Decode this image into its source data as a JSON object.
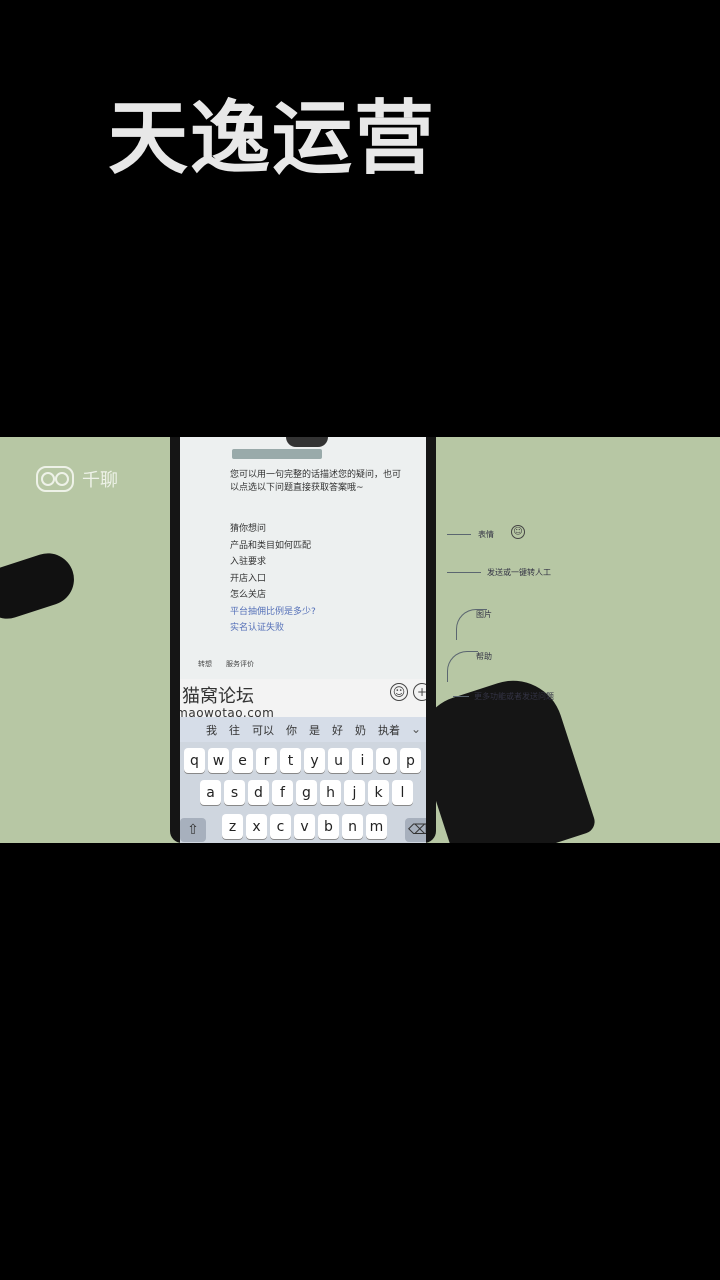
{
  "header": {
    "title": "天逸运营"
  },
  "brand": {
    "logo_text": "千聊"
  },
  "chat": {
    "message": "您可以用一句完整的话描述您的疑问，也可以点选以下问题直接获取答案哦~",
    "menu_heading": "猜你想问",
    "menu_items": [
      "产品和类目如何匹配",
      "入驻要求",
      "开店入口",
      "怎么关店",
      "平台抽佣比例是多少?",
      "实名认证失败"
    ],
    "tabs": [
      "转想",
      "服务评价"
    ]
  },
  "overlay": {
    "forum_name": "猫窝论坛",
    "forum_url": "www.maowotao.com"
  },
  "keyboard": {
    "suggestions": [
      "我",
      "往",
      "可以",
      "你",
      "是",
      "好",
      "奶",
      "执着"
    ],
    "row1": [
      "q",
      "w",
      "e",
      "r",
      "t",
      "y",
      "u",
      "i",
      "o",
      "p"
    ],
    "row2": [
      "a",
      "s",
      "d",
      "f",
      "g",
      "h",
      "j",
      "k",
      "l"
    ],
    "row3": [
      "z",
      "x",
      "c",
      "v",
      "b",
      "n",
      "m"
    ],
    "shift": "⇧",
    "delete": "⌫",
    "collapse": "⌄"
  },
  "annotations": [
    "表情",
    "发送或一键转人工",
    "图片",
    "帮助",
    "更多功能或者发送问题"
  ]
}
